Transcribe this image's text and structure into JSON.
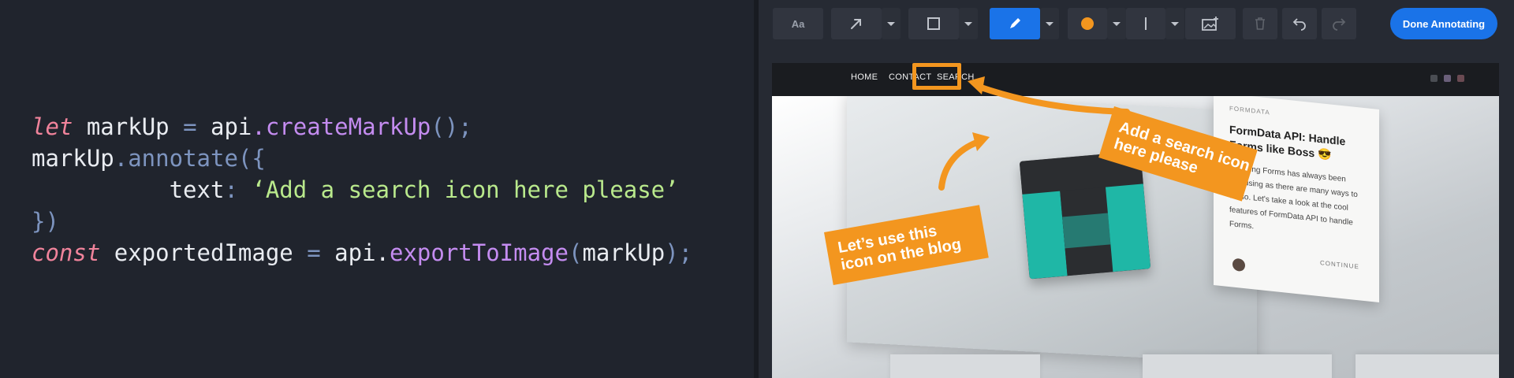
{
  "code": {
    "lines": [
      [
        {
          "t": "let",
          "c": "kw"
        },
        {
          "t": " markUp ",
          "c": "id"
        },
        {
          "t": "=",
          "c": "pn"
        },
        {
          "t": " api",
          "c": "id"
        },
        {
          "t": ".createMarkUp",
          "c": "fn"
        },
        {
          "t": "();",
          "c": "pn"
        }
      ],
      [
        {
          "t": "markUp",
          "c": "id"
        },
        {
          "t": ".annotate",
          "c": "pn"
        },
        {
          "t": "({",
          "c": "pn"
        }
      ],
      [
        {
          "t": "          text",
          "c": "id"
        },
        {
          "t": ": ",
          "c": "pn"
        },
        {
          "t": "‘Add a search icon here please’",
          "c": "st"
        }
      ],
      [
        {
          "t": "})",
          "c": "pn"
        }
      ],
      [
        {
          "t": "const",
          "c": "kw"
        },
        {
          "t": " exportedImage ",
          "c": "id"
        },
        {
          "t": "=",
          "c": "pn"
        },
        {
          "t": " api.",
          "c": "id"
        },
        {
          "t": "exportToImage",
          "c": "fn"
        },
        {
          "t": "(",
          "c": "pn"
        },
        {
          "t": "markUp",
          "c": "id"
        },
        {
          "t": ");",
          "c": "pn"
        }
      ]
    ]
  },
  "toolbar": {
    "text_tool_label": "Aa",
    "done_label": "Done Annotating",
    "accent_color": "#1a73e8",
    "annotation_color": "#f3961f",
    "icons": {
      "arrow": "arrow-tool-icon",
      "rect": "rectangle-tool-icon",
      "pen": "pen-tool-icon",
      "color": "color-dot-icon",
      "stroke": "stroke-width-icon",
      "image": "add-image-icon",
      "trash": "trash-icon",
      "undo": "undo-icon",
      "redo": "redo-icon"
    }
  },
  "site": {
    "nav": [
      "HOME",
      "CONTACT",
      "SEARCH"
    ],
    "side_card": {
      "tag": "FORMDATA",
      "title": "FormData API: Handle Forms like Boss 😎",
      "text": "Handling Forms has always been confusing as there are many ways to do so. Let's take a look at the cool features of FormData API to handle Forms.",
      "more": "CONTINUE"
    }
  },
  "annotations": {
    "search_note": "Add a search icon\nhere please",
    "blog_note": "Let’s use this\nicon on the blog"
  }
}
